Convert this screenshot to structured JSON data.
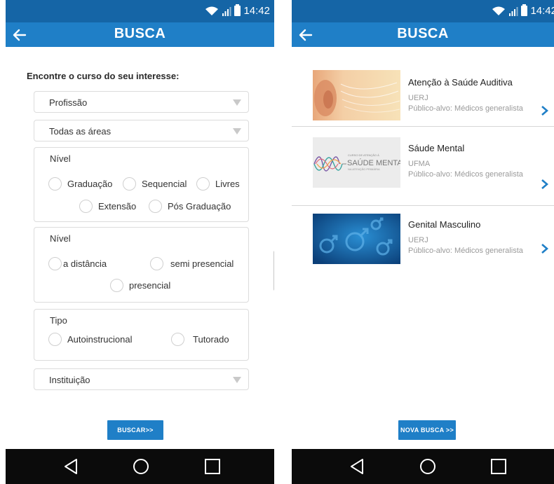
{
  "status_bar": {
    "time_left": "14:42",
    "time_right": "14:42"
  },
  "left_screen": {
    "app_bar": {
      "title": "BUSCA"
    },
    "form": {
      "heading": "Encontre o curso do seu interesse:",
      "profession_select": "Profissão",
      "area_select": "Todas as áreas",
      "level_group": {
        "title": "Nível",
        "options": [
          "Graduação",
          "Sequencial",
          "Livres",
          "Extensão",
          "Pós Graduação"
        ]
      },
      "modality_group": {
        "title": "Nível",
        "options": [
          "a distância",
          "semi presencial",
          "presencial"
        ]
      },
      "type_group": {
        "title": "Tipo",
        "options": [
          "Autoinstrucional",
          "Tutorado"
        ]
      },
      "institution_select": "Instituição",
      "search_button": "BUSCAR>>"
    }
  },
  "right_screen": {
    "app_bar": {
      "title": "BUSCA"
    },
    "courses": [
      {
        "title": "Atenção à Saúde Auditiva",
        "institution": "UERJ",
        "audience": "Público-alvo: Médicos generalista"
      },
      {
        "title": "Sáude Mental",
        "institution": "UFMA",
        "audience": "Público-alvo: Médicos generalista"
      },
      {
        "title": "Genital Masculino",
        "institution": "UERJ",
        "audience": "Público-alvo: Médicos generalista"
      }
    ],
    "thumb_texts": {
      "mental_top": "CURSO DE ATENÇÃO À",
      "mental_main": "SAÚDE MENTAL",
      "mental_sub": "NA ATENÇÃO PRIMÁRIA"
    },
    "new_search_button": "NOVA BUSCA >>"
  },
  "colors": {
    "status_bar": "#1565a6",
    "app_bar": "#1f7fc7",
    "accent": "#1f7fc7",
    "nav_bar": "#0b0b0b"
  },
  "icons": [
    "wifi-icon",
    "signal-icon",
    "battery-icon",
    "back-arrow-icon",
    "caret-down-icon",
    "chevron-right-icon",
    "nav-back-icon",
    "nav-home-icon",
    "nav-recents-icon"
  ]
}
